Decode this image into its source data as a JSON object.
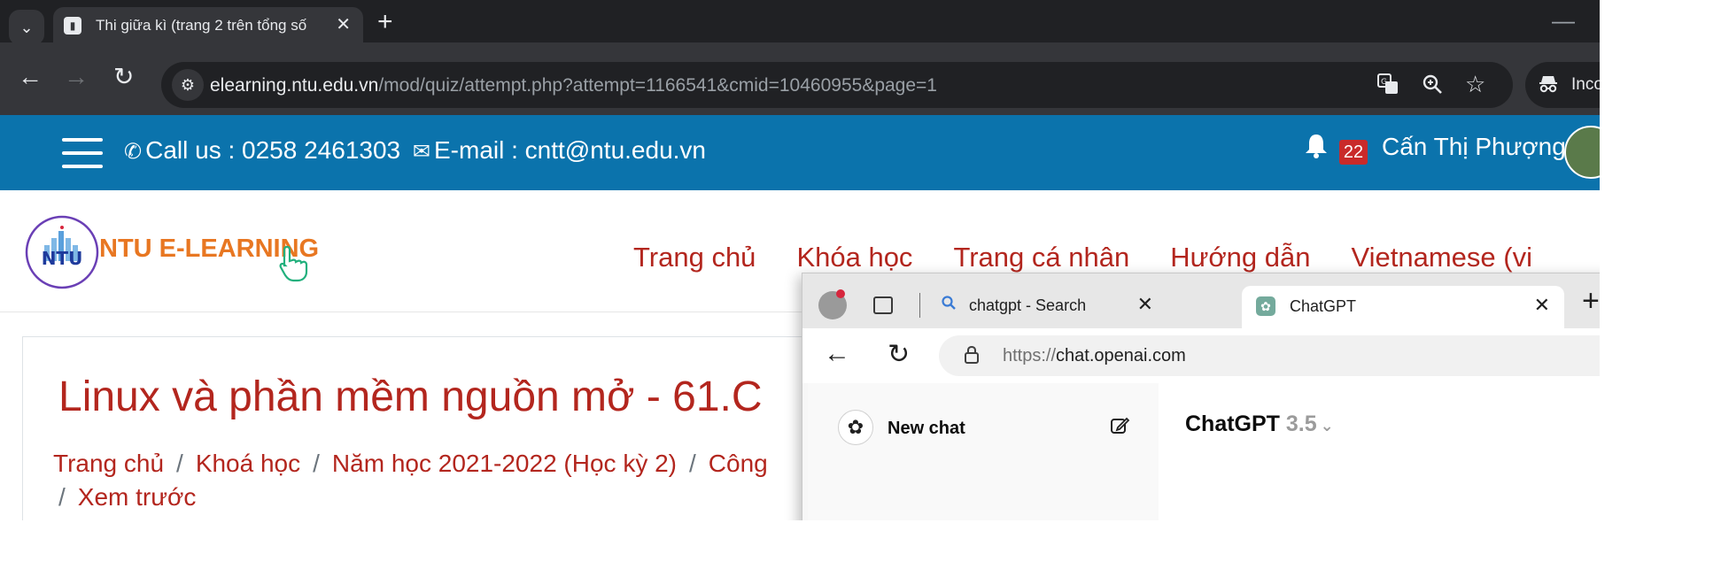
{
  "browser": {
    "tab_title": "Thi giữa kì (trang 2 trên tổng số",
    "url_host": "elearning.ntu.edu.vn",
    "url_path": "/mod/quiz/attempt.php?attempt=1166541&cmid=10460955&page=1",
    "profile_label": "Inco"
  },
  "site": {
    "contact": "Call us : 0258 2461303",
    "email": "E-mail : cntt@ntu.edu.vn",
    "notif_count": "22",
    "user_name": "Cấn Thị Phượng",
    "logo_text": "NTU E-LEARNING",
    "logo_abbr": "NTU",
    "menu": [
      "Trang chủ",
      "Khóa học",
      "Trang cá nhân",
      "Hướng dẫn",
      "Vietnamese (vi"
    ]
  },
  "page": {
    "title": "Linux và phần mềm nguồn mở - 61.C",
    "breadcrumb": [
      "Trang chủ",
      "Khoá học",
      "Năm học 2021-2022 (Học kỳ 2)",
      "Công"
    ],
    "breadcrumb_last": "Xem trước"
  },
  "edge": {
    "tab1_title": "chatgpt - Search",
    "tab2_title": "ChatGPT",
    "url_scheme": "https://",
    "url_host": "chat.openai.com",
    "new_chat": "New chat",
    "model_name": "ChatGPT",
    "model_version": "3.5"
  },
  "colors": {
    "brand_blue": "#0b73ac",
    "brand_red": "#b3261e",
    "logo_orange": "#e87722"
  }
}
